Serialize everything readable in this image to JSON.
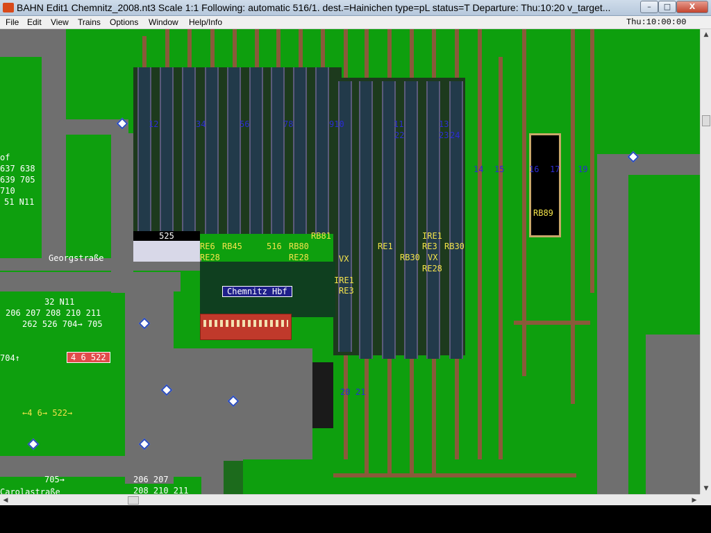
{
  "window": {
    "title": "BAHN Edit1 Chemnitz_2008.nt3 Scale 1:1 Following: automatic 516/1.  dest.=Hainichen type=pL status=T  Departure: Thu:10:20 v_target...",
    "min_label": "–",
    "max_label": "□",
    "close_label": "X"
  },
  "menu": {
    "items": [
      "File",
      "Edit",
      "View",
      "Trains",
      "Options",
      "Window",
      "Help/Info"
    ],
    "clock": "Thu:10:00:00"
  },
  "map": {
    "station_name": "Chemnitz Hbf",
    "platform_number": "525",
    "street_georg": "Georgstraße",
    "street_carola": "Carolastraße",
    "left_lines": [
      "of",
      "637 638",
      "639 705",
      "710",
      "51 N11"
    ],
    "bus_lines_a": "32 N11",
    "bus_lines_b": "206 207 208 210 211",
    "bus_lines_c": "262 526 704→ 705",
    "bus_704": "704↑",
    "red_badge": "4 6 522",
    "tram_lines": "←4 6→ 522→",
    "tram_705": "705→",
    "bottom_lines_a": "206 207",
    "bottom_lines_b": "208 210 211",
    "train_labels": {
      "re6": "RE6",
      "rb45": "RB45",
      "n516": "516",
      "rb80": "RB80",
      "rb81": "RB81",
      "re28a": "RE28",
      "re28b": "RE28",
      "vx1": "VX",
      "ire1a": "IRE1",
      "re3a": "RE3",
      "re1": "RE1",
      "rb30a": "RB30",
      "ire1b": "IRE1",
      "re3b": "RE3",
      "rb30b": "RB30",
      "vx2": "VX",
      "re28c": "RE28",
      "rb89": "RB89"
    },
    "track_numbers": [
      "12",
      "34",
      "56",
      "78",
      "910",
      "11",
      "13",
      "14",
      "15",
      "16",
      "17",
      "19",
      "20",
      "21",
      "22",
      "23",
      "24"
    ]
  }
}
